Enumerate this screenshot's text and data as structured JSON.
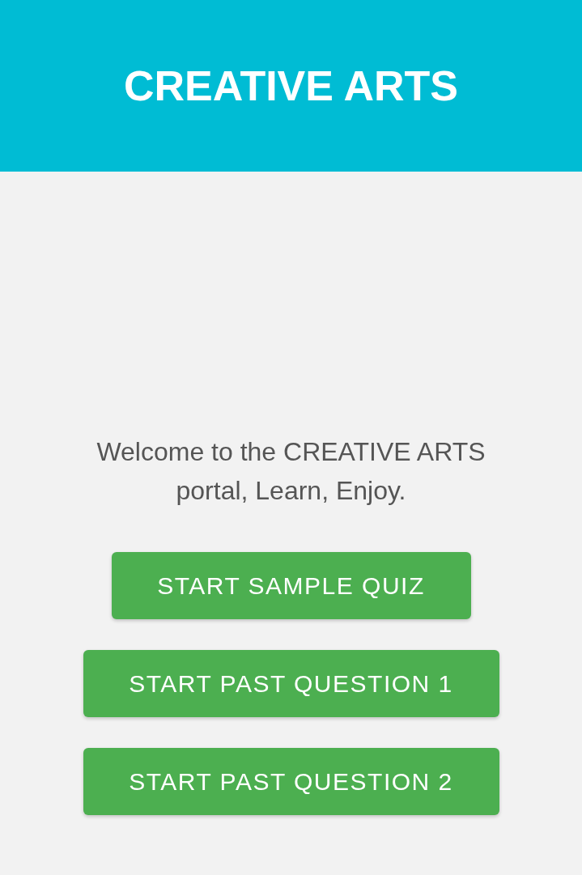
{
  "header": {
    "title": "CREATIVE ARTS"
  },
  "welcome": "Welcome to the CREATIVE ARTS portal, Learn, Enjoy.",
  "buttons": [
    {
      "label": "START SAMPLE QUIZ"
    },
    {
      "label": "START PAST QUESTION 1"
    },
    {
      "label": "START PAST QUESTION 2"
    }
  ]
}
